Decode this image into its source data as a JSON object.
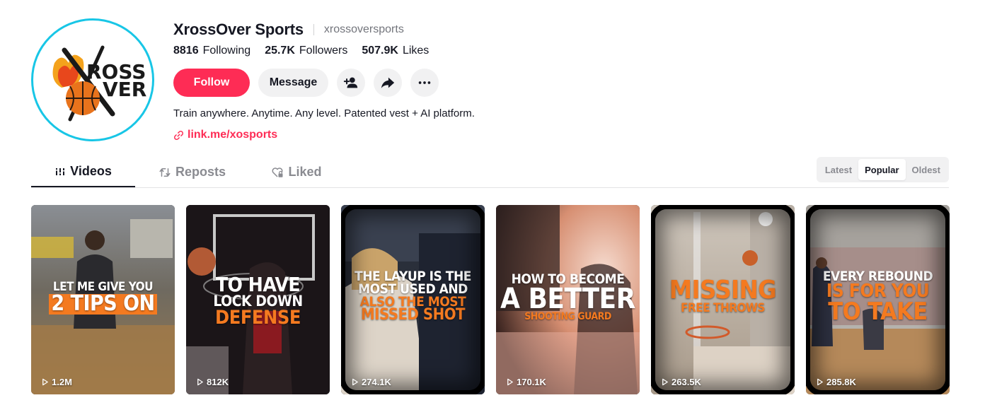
{
  "profile": {
    "display_name": "XrossOver Sports",
    "username": "xrossoversports",
    "logo_text_line1": "ROSS",
    "logo_text_line2": "VER",
    "logo_letter": "X",
    "logo_letter2": "O",
    "stats": {
      "following_count": "8816",
      "following_label": "Following",
      "followers_count": "25.7K",
      "followers_label": "Followers",
      "likes_count": "507.9K",
      "likes_label": "Likes"
    },
    "follow_label": "Follow",
    "message_label": "Message",
    "bio": "Train anywhere. Anytime. Any level. Patented vest + AI platform.",
    "link": "link.me/xosports",
    "icons": {
      "add_friend": "person-plus-icon",
      "share": "share-arrow-icon",
      "more": "more-dots-icon",
      "link": "link-icon"
    }
  },
  "tabs": {
    "videos": "Videos",
    "reposts": "Reposts",
    "liked": "Liked"
  },
  "sort": {
    "latest": "Latest",
    "popular": "Popular",
    "oldest": "Oldest",
    "selected": "Popular"
  },
  "videos": [
    {
      "plays": "1.2M",
      "lines": [
        "LET ME GIVE YOU",
        "2 TIPS ON"
      ]
    },
    {
      "plays": "812K",
      "lines": [
        "TO HAVE",
        "LOCK DOWN",
        "DEFENSE"
      ]
    },
    {
      "plays": "274.1K",
      "lines": [
        "THE LAYUP IS THE",
        "MOST USED AND",
        "ALSO THE MOST",
        "MISSED SHOT"
      ]
    },
    {
      "plays": "170.1K",
      "lines": [
        "HOW TO BECOME",
        "A BETTER",
        "SHOOTING GUARD"
      ]
    },
    {
      "plays": "263.5K",
      "lines": [
        "MISSING",
        "FREE THROWS"
      ]
    },
    {
      "plays": "285.8K",
      "lines": [
        "EVERY REBOUND",
        "IS FOR YOU",
        "TO TAKE"
      ]
    }
  ],
  "colors": {
    "brand_red": "#fe2c55",
    "text": "#161823",
    "muted": "#73757c",
    "overlay_orange": "#f47a20",
    "avatar_ring": "#18c6e6"
  }
}
